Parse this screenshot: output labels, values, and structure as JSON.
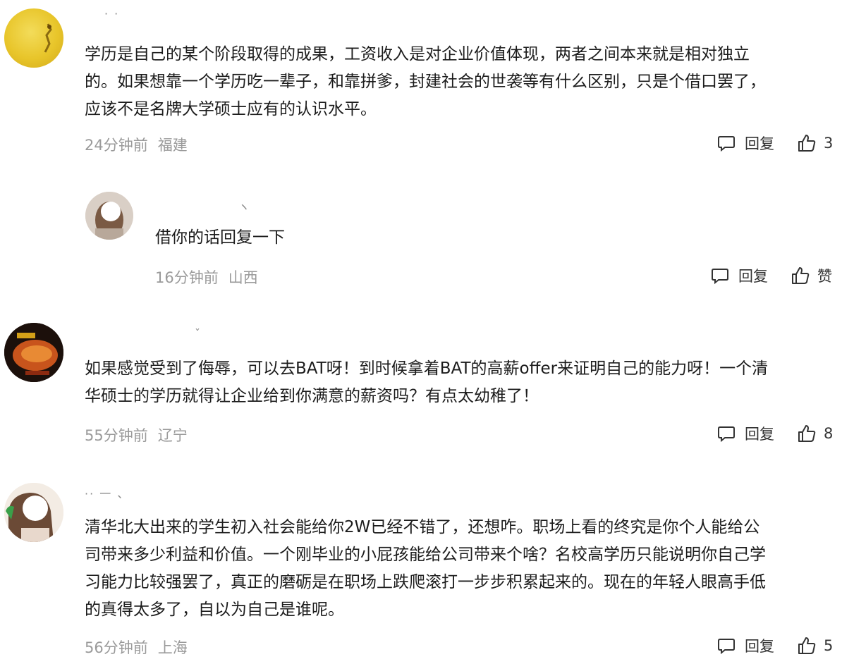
{
  "comments": [
    {
      "username": "· ·",
      "content_lines": [
        "学历是自己的某个阶段取得的成果，工资收入是对企业价值体现，两者之间本来就是相对独立",
        "的。如果想靠一个学历吃一辈子，和靠拼爹，封建社会的世袭等有什么区别，只是个借口罢了，",
        "应该不是名牌大学硕士应有的认识水平。"
      ],
      "time": "24分钟前",
      "location": "福建",
      "reply_label": "回复",
      "like_count": "3"
    },
    {
      "username": "ヽ",
      "content_lines": [
        "借你的话回复一下"
      ],
      "time": "16分钟前",
      "location": "山西",
      "reply_label": "回复",
      "like_count": "赞"
    },
    {
      "username": "ˇ",
      "content_lines": [
        "如果感觉受到了侮辱，可以去BAT呀！到时候拿着BAT的高薪offer来证明自己的能力呀！一个清",
        "华硕士的学历就得让企业给到你满意的薪资吗？有点太幼稚了！"
      ],
      "time": "55分钟前",
      "location": "辽宁",
      "reply_label": "回复",
      "like_count": "8"
    },
    {
      "username": "·· 一 、",
      "content_lines": [
        "清华北大出来的学生初入社会能给你2W已经不错了，还想咋。职场上看的终究是你个人能给公",
        "司带来多少利益和价值。一个刚毕业的小屁孩能给公司带来个啥？名校高学历只能说明你自己学",
        "习能力比较强罢了，真正的磨砺是在职场上跌爬滚打一步步积累起来的。现在的年轻人眼高手低",
        "的真得太多了，自以为自己是谁呢。"
      ],
      "time": "56分钟前",
      "location": "上海",
      "reply_label": "回复",
      "like_count": "5"
    }
  ]
}
